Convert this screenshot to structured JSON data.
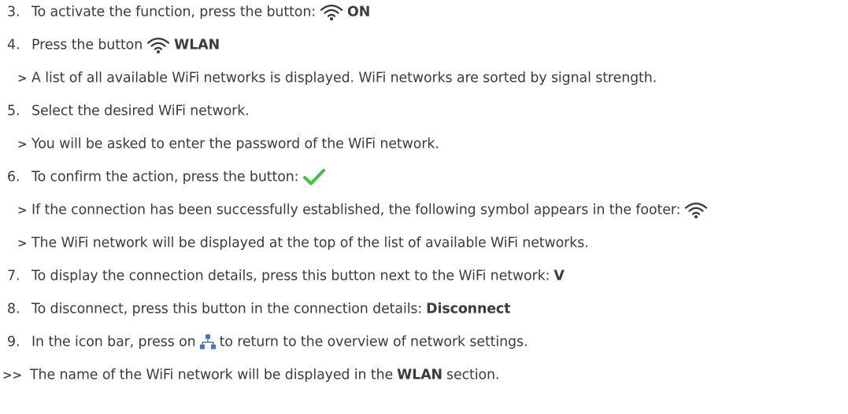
{
  "steps": [
    {
      "marker": "3.",
      "text": "To activate the function, press the button:",
      "bold": "ON"
    },
    {
      "marker": "4.",
      "text": "Press the button",
      "bold": "WLAN"
    },
    {
      "marker": ">",
      "text": "A list of all available WiFi networks is displayed. WiFi networks are sorted by signal strength."
    },
    {
      "marker": "5.",
      "text": "Select the desired WiFi network."
    },
    {
      "marker": ">",
      "text": "You will be asked to enter the password of the WiFi network."
    },
    {
      "marker": "6.",
      "text": "To confirm the action, press the button:"
    },
    {
      "marker": ">",
      "text": "If the connection has been successfully established, the following symbol appears in the footer:"
    },
    {
      "marker": ">",
      "text": "The WiFi network will be displayed at the top of the list of available WiFi networks."
    },
    {
      "marker": "7.",
      "text": "To display the connection details, press this button next to the WiFi network:",
      "bold": "V"
    },
    {
      "marker": "8.",
      "text": "To disconnect, press this button in the connection details:",
      "bold": "Disconnect"
    },
    {
      "marker": "9.",
      "text_before": "In the icon bar, press on",
      "text_after": "to return to the overview of network settings."
    },
    {
      "marker": ">>",
      "text_before": "The name of the WiFi network will be displayed in the",
      "bold": "WLAN",
      "text_after": "section."
    }
  ],
  "icons": {
    "wifi": "wifi-icon",
    "check": "checkmark-icon",
    "network": "network-icon"
  },
  "colors": {
    "text": "#3c3c3c",
    "check": "#3cc43c",
    "network": "#3a7bd5"
  }
}
